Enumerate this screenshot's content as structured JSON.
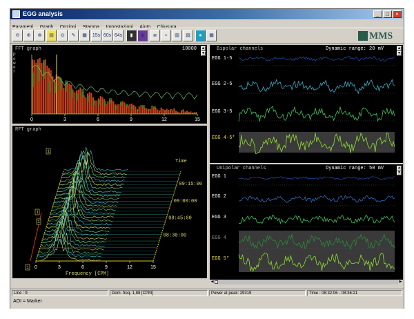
{
  "window": {
    "title": "EGG analysis"
  },
  "menu": [
    "Parametri",
    "Graph",
    "Opzioni",
    "Stampa",
    "Impostazioni",
    "Aiuto",
    "Chiusura"
  ],
  "toolbar": {
    "labels": {
      "b15s": "15s",
      "b60s": "60s",
      "b64s": "64s"
    }
  },
  "logo": {
    "text": "MMS"
  },
  "fft": {
    "title": "FFT graph",
    "value": "10000",
    "ylabel": "P o w e r",
    "xticks": [
      "0",
      "3",
      "6",
      "9",
      "12",
      "15"
    ]
  },
  "rft": {
    "title": "RFT graph",
    "time_label": "Time",
    "times": [
      "09:15:00",
      "09:00:00",
      "08:45:00",
      "08:30:00"
    ],
    "xticks": [
      "0",
      "3",
      "6",
      "9",
      "12",
      "15"
    ],
    "xlabel": "Frequency [CPM]",
    "markers": [
      "1",
      "1",
      "1",
      "1"
    ]
  },
  "bipolar": {
    "title": "Bipolar channels",
    "range": "Dynamic range: 20 mV",
    "channels": [
      "EGG 1-5",
      "EGG 2-5",
      "EGG 3-5",
      "EGG 4-5*"
    ]
  },
  "unipolar": {
    "title": "Unipolar channels",
    "range": "Dynamic range: 50 mV",
    "channels": [
      "EGG 1",
      "EGG 2",
      "EGG 3",
      "EGG 4",
      "EGG 5*"
    ]
  },
  "status": {
    "line": "Line : 9",
    "dom_freq": "Dom. freq. 1,88 [CPM]",
    "power_peak": "Power at peak: 29319",
    "time": "Time : 08:32:06 - 08:36:21"
  },
  "bottom": {
    "aoi": "AOI = Marker"
  },
  "colors": {
    "titlebar": "#0a246a",
    "fft_bars": "#c8401a",
    "fft_green": "#2a8a2a",
    "waveform_blue": "#1c4aa8",
    "waveform_cyan": "#3ab0d0",
    "waveform_green": "#40c860",
    "waveform_lime": "#90e030",
    "axis_yellow": "#d0c830"
  }
}
